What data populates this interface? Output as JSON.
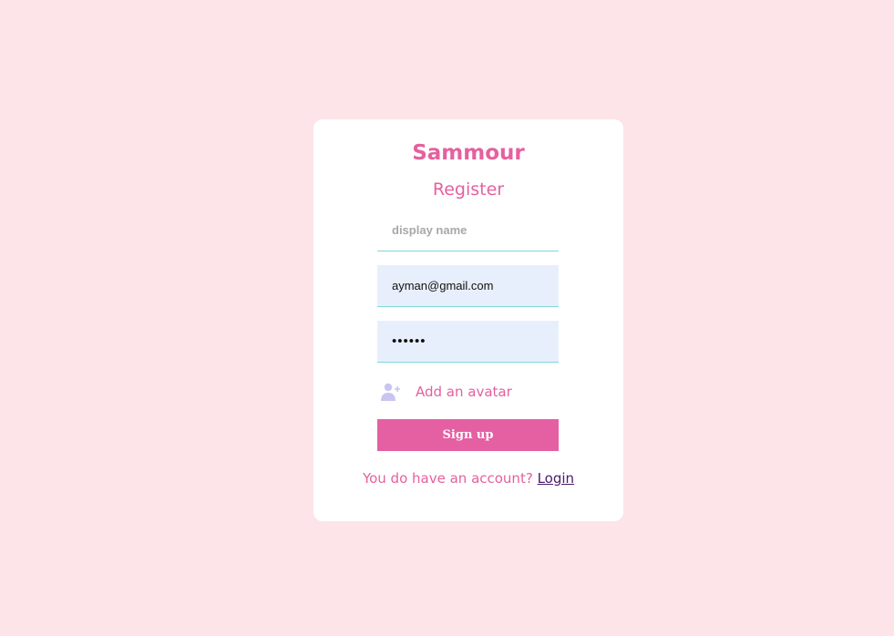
{
  "brand": "Sammour",
  "form": {
    "title": "Register",
    "display_name": {
      "placeholder": "display name",
      "value": ""
    },
    "email": {
      "value": "ayman@gmail.com"
    },
    "password": {
      "value": "••••••"
    },
    "avatar": {
      "icon": "add-user-icon",
      "label": "Add an avatar"
    },
    "submit_label": "Sign up"
  },
  "footer": {
    "prompt": "You do have an account?",
    "link_label": "Login"
  },
  "colors": {
    "background": "#fde4e8",
    "accent": "#e5609f",
    "button": "#e55fa3",
    "input_fill": "#e8effc",
    "input_underline": "#7fd8d8",
    "link": "#4b1a6e",
    "icon": "#c9c5f0"
  }
}
